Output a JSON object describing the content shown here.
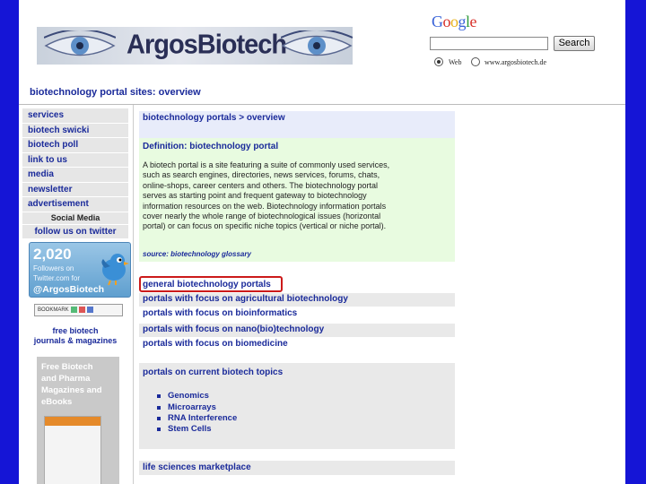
{
  "header": {
    "logo_text": "ArgosBiotech",
    "search_button": "Search",
    "search_value": "",
    "radio_web": "Web",
    "radio_site": "www.argosbiotech.de",
    "google_letters": [
      {
        "ch": "G",
        "color": "#3a63d8"
      },
      {
        "ch": "o",
        "color": "#d8312a"
      },
      {
        "ch": "o",
        "color": "#e8b21b"
      },
      {
        "ch": "g",
        "color": "#3a63d8"
      },
      {
        "ch": "l",
        "color": "#2e9b3a"
      },
      {
        "ch": "e",
        "color": "#d8312a"
      }
    ]
  },
  "page_title": "biotechnology portal sites: overview",
  "nav": {
    "items": [
      "services",
      "biotech swicki",
      "biotech poll",
      "link to us",
      "media",
      "newsletter",
      "advertisement"
    ],
    "social_media": "Social Media",
    "follow": "follow us on twitter"
  },
  "twitter": {
    "count": "2,020",
    "line1": "Followers on",
    "line2": "Twitter.com for",
    "handle": "@ArgosBiotech"
  },
  "share_label": "BOOKMARK",
  "free_journals": [
    "free biotech",
    "journals & magazines"
  ],
  "magazine_promo": [
    "Free Biotech",
    "and Pharma",
    "Magazines and",
    "eBooks"
  ],
  "content": {
    "heading": "biotechnology portals > overview",
    "definition_title": "Definition: biotechnology portal",
    "definition_lines": [
      "A biotech portal is a site featuring a suite of commonly used services,",
      "such as search engines, directories, news services, forums, chats,",
      "online-shops, career centers and others. The biotechnology portal",
      "serves as starting point and frequent gateway to biotechnology",
      "information resources on the web. Biotechnology information portals",
      "cover nearly the whole range of biotechnological issues (horizontal",
      "portal) or can focus on specific niche topics (vertical or niche portal)."
    ],
    "source_label": "source:",
    "source_link": "biotechnology glossary",
    "links": [
      "general biotechnology portals",
      "portals with focus on agricultural biotechnology",
      "portals with focus on bioinformatics",
      "portals with focus on nano(bio)technology",
      "portals with focus on biomedicine"
    ],
    "current_topics_heading": "portals on current biotech topics",
    "topics": [
      "Genomics",
      "Microarrays",
      "RNA Interference",
      "Stem Cells"
    ],
    "marketplace": "life sciences marketplace"
  },
  "colors": {
    "frame_blue": "#1515d6",
    "link_blue": "#1a2a9a",
    "definition_bg": "#e8fbe0",
    "heading_bg": "#e8ecfa",
    "band_bg": "#e9e9e9",
    "highlight_red": "#cc1a1a"
  }
}
